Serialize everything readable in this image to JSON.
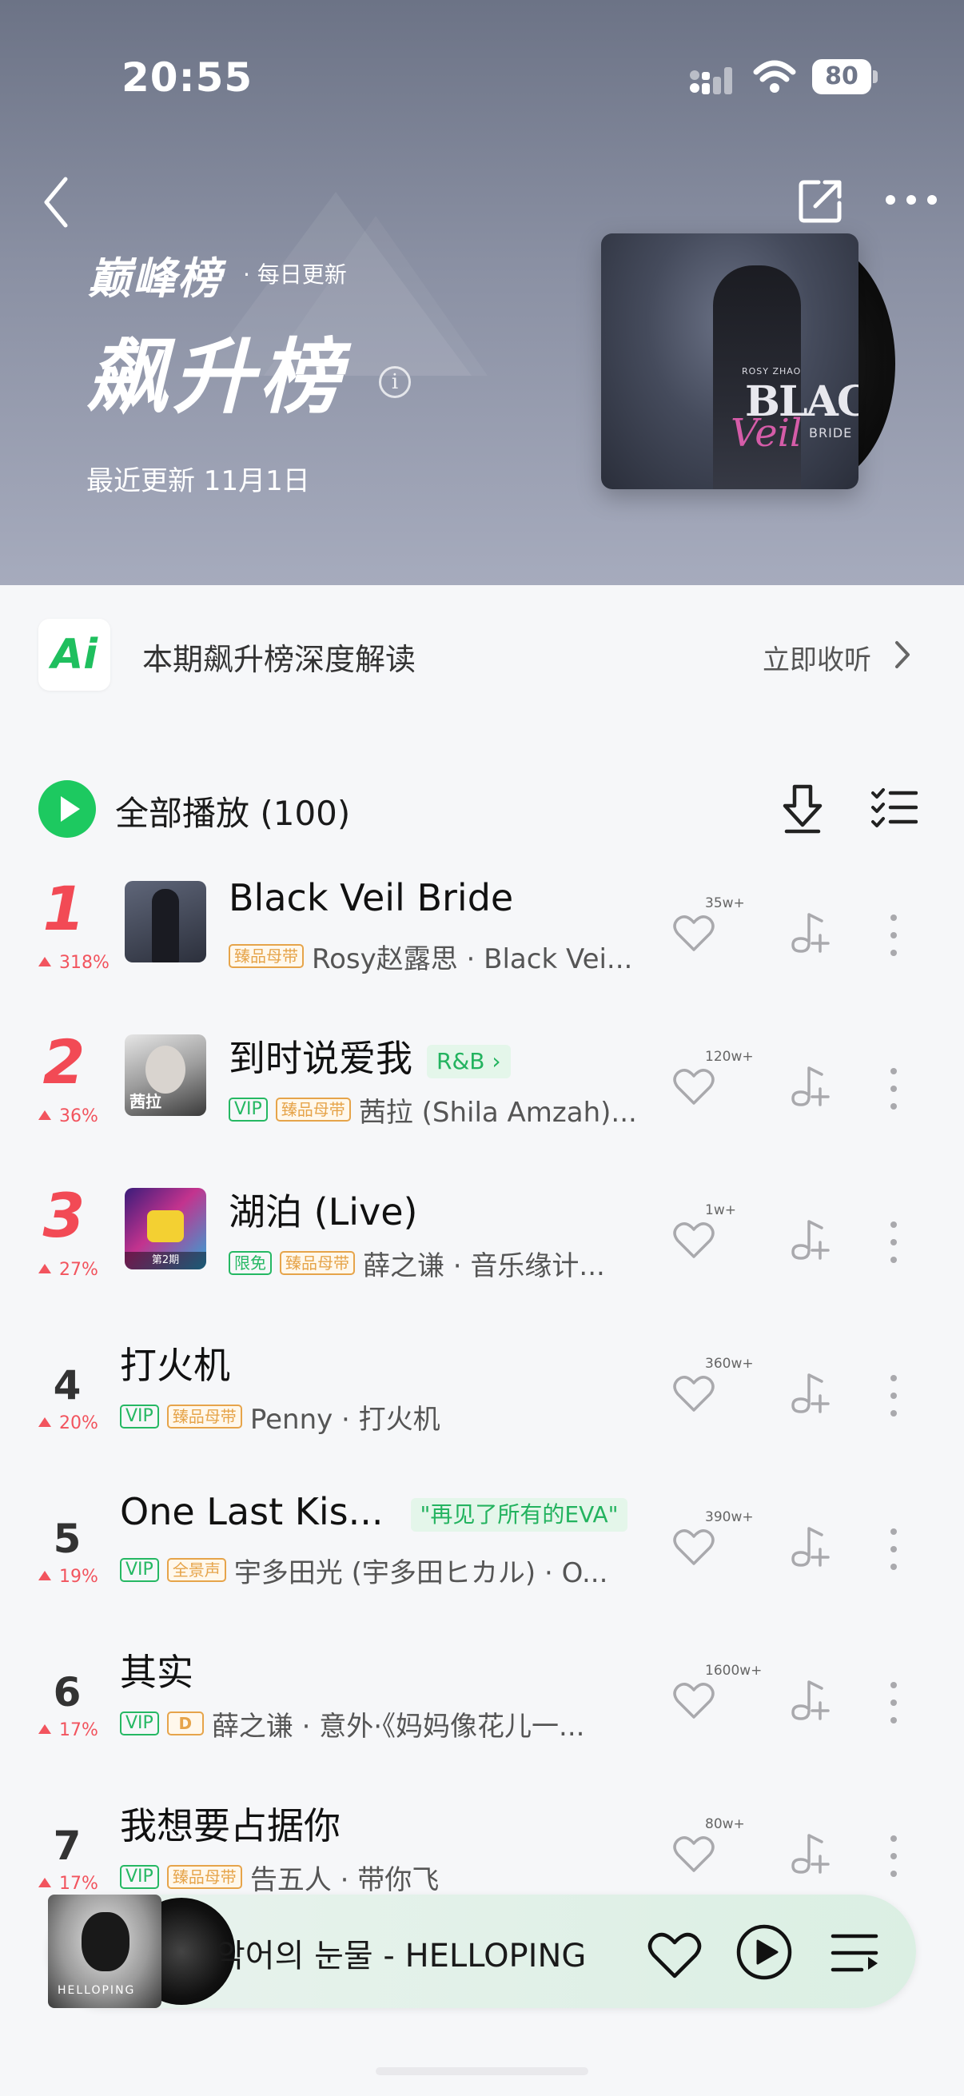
{
  "status_bar": {
    "time": "20:55",
    "battery": "80"
  },
  "header": {
    "brand": "巅峰榜",
    "update_tag": "· 每日更新",
    "title": "飙升榜",
    "last_update": "最近更新 11月1日",
    "cover": {
      "top_line": "ROSY ZHAO",
      "word1": "BLACK",
      "word2": "Veil",
      "word3": "BRIDE"
    }
  },
  "ai_banner": {
    "logo": "Ai",
    "text": "本期飙升榜深度解读",
    "action": "立即收听"
  },
  "toolbar": {
    "play_all": "全部播放 (100)"
  },
  "songs": [
    {
      "rank": "1",
      "trend": "318%",
      "title": "Black Veil Bride",
      "badges": [
        "臻品母带"
      ],
      "artist": "Rosy赵露思 · Black Vei...",
      "likes": "35w+"
    },
    {
      "rank": "2",
      "trend": "36%",
      "title": "到时说爱我",
      "genre": "R&B",
      "badges": [
        "VIP",
        "臻品母带"
      ],
      "artist": "茜拉 (Shila Amzah)...",
      "likes": "120w+",
      "thumb_label": "茜拉"
    },
    {
      "rank": "3",
      "trend": "27%",
      "title": "湖泊 (Live)",
      "badges": [
        "限免",
        "臻品母带"
      ],
      "artist": "薛之谦 · 音乐缘计...",
      "likes": "1w+",
      "thumb_label": "第2期"
    },
    {
      "rank": "4",
      "trend": "20%",
      "title": "打火机",
      "badges": [
        "VIP",
        "臻品母带"
      ],
      "artist": "Penny · 打火机",
      "likes": "360w+"
    },
    {
      "rank": "5",
      "trend": "19%",
      "title": "One Last Kis...",
      "genre": "\"再见了所有的EVA\"",
      "badges": [
        "VIP",
        "全景声"
      ],
      "artist": "宇多田光 (宇多田ヒカル) · O...",
      "likes": "390w+"
    },
    {
      "rank": "6",
      "trend": "17%",
      "title": "其实",
      "badges": [
        "VIP",
        "D"
      ],
      "artist": "薛之谦 · 意外·《妈妈像花儿一...",
      "likes": "1600w+"
    },
    {
      "rank": "7",
      "trend": "17%",
      "title": "我想要占据你",
      "badges": [
        "VIP",
        "臻品母带"
      ],
      "artist": "告五人 · 带你飞",
      "likes": "80w+"
    }
  ],
  "mini_player": {
    "title": "악어의 눈물 - HELLOPING",
    "cover_text": "HELLOPING"
  },
  "colors": {
    "accent_green": "#1dc960",
    "rank_red": "#f24a55",
    "header_bg": "#7a8195"
  }
}
